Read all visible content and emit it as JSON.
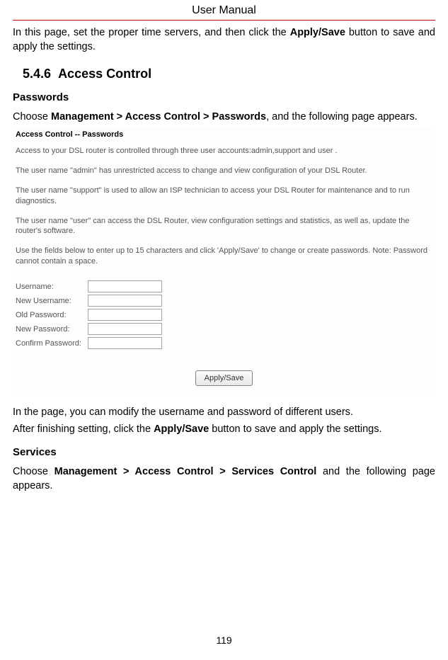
{
  "header": {
    "title": "User Manual"
  },
  "intro": {
    "prefix": "In this page, set the proper time servers, and then click the ",
    "bold": "Apply/Save",
    "suffix": " button to save and apply the settings."
  },
  "section": {
    "number": "5.4.6",
    "title": "Access Control"
  },
  "passwords": {
    "heading": "Passwords",
    "line_prefix": "Choose ",
    "line_bold": "Management > Access Control > Passwords",
    "line_suffix": ", and the following page appears."
  },
  "panel": {
    "title": "Access Control -- Passwords",
    "p1": "Access to your DSL router is controlled through three user accounts:admin,support and user .",
    "p2": "The user name \"admin\" has unrestricted access to change and view configuration of your DSL Router.",
    "p3": "The user name \"support\" is used to allow an ISP technician to access your DSL Router for maintenance and to run diagnostics.",
    "p4": "The user name \"user\" can access the DSL Router, view configuration settings and statistics, as well as, update the router's software.",
    "p5": "Use the fields below to enter up to 15 characters and click 'Apply/Save' to change or create passwords. Note: Password cannot contain a space.",
    "form": {
      "username_label": "Username:",
      "new_username_label": "New Username:",
      "old_password_label": "Old Password:",
      "new_password_label": "New Password:",
      "confirm_password_label": "Confirm Password:",
      "username": "",
      "new_username": "",
      "old_password": "",
      "new_password": "",
      "confirm_password": ""
    },
    "button": "Apply/Save"
  },
  "after": {
    "line1": "In the page, you can modify the username and password of different users.",
    "line2_prefix": "After finishing setting, click the ",
    "line2_bold": "Apply/Save",
    "line2_suffix": " button to save and apply the settings."
  },
  "services": {
    "heading": "Services",
    "line_prefix": "Choose ",
    "line_bold": "Management > Access Control > Services Control",
    "line_suffix": " and the following page appears."
  },
  "page_number": "119"
}
